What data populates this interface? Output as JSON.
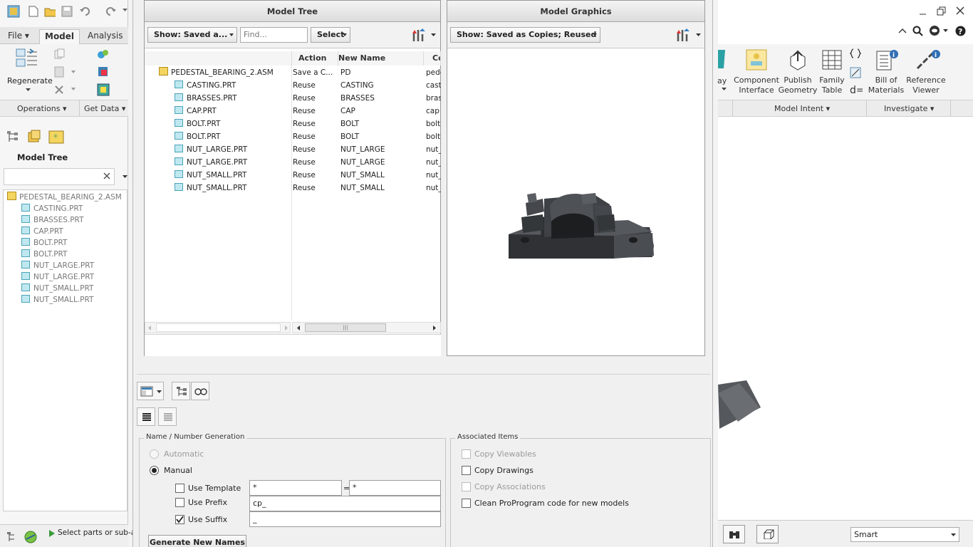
{
  "left_app": {
    "tabs": [
      "File",
      "Model",
      "Analysis"
    ],
    "regenerate_label": "Regenerate",
    "groups": [
      "Operations",
      "Get Data"
    ],
    "model_tree_title": "Model Tree",
    "search_placeholder": "",
    "tree": [
      {
        "label": "PEDESTAL_BEARING_2.ASM",
        "type": "asm"
      },
      {
        "label": "CASTING.PRT",
        "type": "prt"
      },
      {
        "label": "BRASSES.PRT",
        "type": "prt"
      },
      {
        "label": "CAP.PRT",
        "type": "prt"
      },
      {
        "label": "BOLT.PRT",
        "type": "prt"
      },
      {
        "label": "BOLT.PRT",
        "type": "prt"
      },
      {
        "label": "NUT_LARGE.PRT",
        "type": "prt"
      },
      {
        "label": "NUT_LARGE.PRT",
        "type": "prt"
      },
      {
        "label": "NUT_SMALL.PRT",
        "type": "prt"
      },
      {
        "label": "NUT_SMALL.PRT",
        "type": "prt"
      }
    ],
    "status_text": "Select parts or sub-asse"
  },
  "right_app": {
    "ribbon_items": [
      {
        "label_line1": "Component",
        "label_line2": "Interface"
      },
      {
        "label_line1": "Publish",
        "label_line2": "Geometry"
      },
      {
        "label_line1": "Family",
        "label_line2": "Table"
      },
      {
        "label_line1": "Bill of",
        "label_line2": "Materials"
      },
      {
        "label_line1": "Reference",
        "label_line2": "Viewer"
      }
    ],
    "cut_label": "ay",
    "groups": [
      "Model Intent",
      "Investigate"
    ],
    "filter_value": "Smart"
  },
  "dialog": {
    "model_tree_panel": {
      "title": "Model Tree",
      "show_dropdown": "Show: Saved a...",
      "find_placeholder": "Find...",
      "select_dropdown": "Select",
      "columns": [
        "Action",
        "New Name",
        "Co"
      ],
      "rows": [
        {
          "name": "PEDESTAL_BEARING_2.ASM",
          "action": "Save a C...",
          "new_name": "PD",
          "extra": "pede",
          "type": "asm"
        },
        {
          "name": "CASTING.PRT",
          "action": "Reuse",
          "new_name": "CASTING",
          "extra": "cast",
          "type": "prt"
        },
        {
          "name": "BRASSES.PRT",
          "action": "Reuse",
          "new_name": "BRASSES",
          "extra": "bras",
          "type": "prt"
        },
        {
          "name": "CAP.PRT",
          "action": "Reuse",
          "new_name": "CAP",
          "extra": "cap",
          "type": "prt"
        },
        {
          "name": "BOLT.PRT",
          "action": "Reuse",
          "new_name": "BOLT",
          "extra": "bolt.",
          "type": "prt"
        },
        {
          "name": "BOLT.PRT",
          "action": "Reuse",
          "new_name": "BOLT",
          "extra": "bolt.",
          "type": "prt"
        },
        {
          "name": "NUT_LARGE.PRT",
          "action": "Reuse",
          "new_name": "NUT_LARGE",
          "extra": "nut_",
          "type": "prt"
        },
        {
          "name": "NUT_LARGE.PRT",
          "action": "Reuse",
          "new_name": "NUT_LARGE",
          "extra": "nut_",
          "type": "prt"
        },
        {
          "name": "NUT_SMALL.PRT",
          "action": "Reuse",
          "new_name": "NUT_SMALL",
          "extra": "nut_",
          "type": "prt"
        },
        {
          "name": "NUT_SMALL.PRT",
          "action": "Reuse",
          "new_name": "NUT_SMALL",
          "extra": "nut_",
          "type": "prt"
        }
      ]
    },
    "graphics_panel": {
      "title": "Model Graphics",
      "show_dropdown": "Show: Saved as Copies; Reused"
    },
    "name_generation": {
      "legend": "Name / Number Generation",
      "automatic_label": "Automatic",
      "manual_label": "Manual",
      "mode": "Manual",
      "use_template_label": "Use Template",
      "use_template_checked": false,
      "template_from": "*",
      "equals": "=",
      "template_to": "*",
      "use_prefix_label": "Use Prefix",
      "use_prefix_checked": false,
      "prefix_value": "cp_",
      "use_suffix_label": "Use Suffix",
      "use_suffix_checked": true,
      "suffix_value": "_",
      "generate_button": "Generate New Names"
    },
    "associated_items": {
      "legend": "Associated Items",
      "items": [
        {
          "label": "Copy Viewables",
          "enabled": false,
          "checked": false
        },
        {
          "label": "Copy Drawings",
          "enabled": true,
          "checked": false
        },
        {
          "label": "Copy Associations",
          "enabled": false,
          "checked": false
        },
        {
          "label": "Clean ProProgram code for new models",
          "enabled": true,
          "checked": false
        }
      ]
    }
  },
  "colors": {
    "accent": "#3c7fb1",
    "part_icon": "#bfe8f0",
    "asm_icon": "#f3d560",
    "model_gray": "#3d3f43"
  }
}
